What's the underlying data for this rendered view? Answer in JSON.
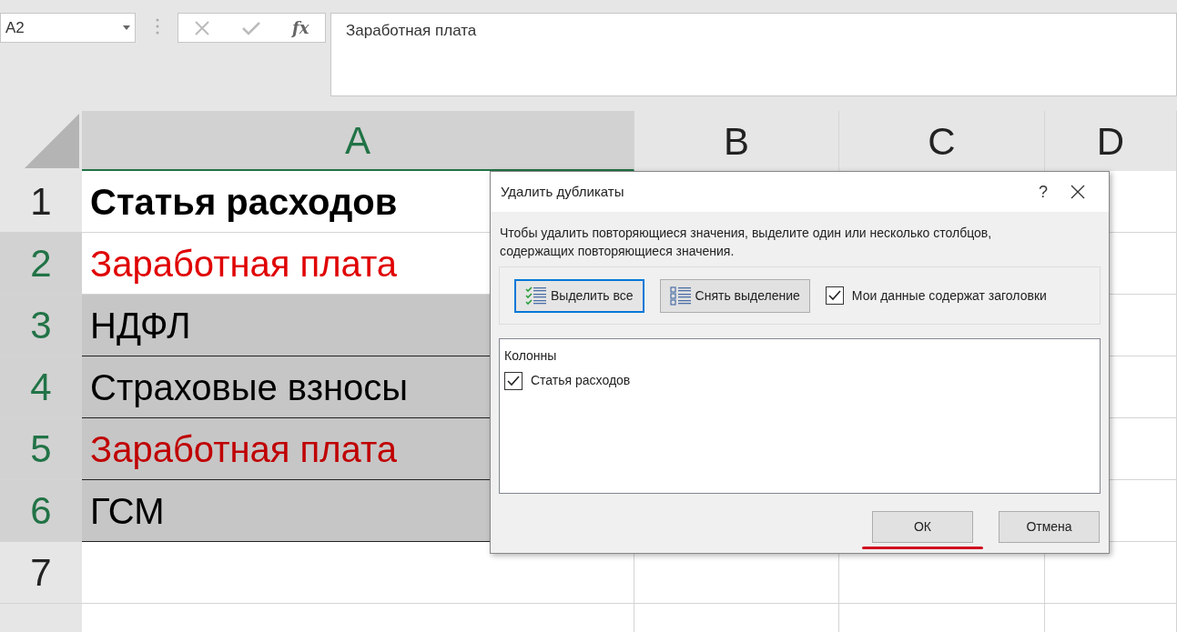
{
  "name_box": {
    "value": "A2"
  },
  "formula_bar": {
    "function_label": "fx",
    "value": "Заработная плата"
  },
  "columns": [
    {
      "label": "A",
      "selected": true
    },
    {
      "label": "B",
      "selected": false
    },
    {
      "label": "C",
      "selected": false
    },
    {
      "label": "D",
      "selected": false
    }
  ],
  "rows": [
    {
      "number": "1",
      "selected": false,
      "cell": {
        "text": "Статья расходов",
        "color": "#000000",
        "bold": true,
        "selected": false
      }
    },
    {
      "number": "2",
      "selected": true,
      "cell": {
        "text": "Заработная плата",
        "color": "#e00000",
        "bold": false,
        "selected": false
      }
    },
    {
      "number": "3",
      "selected": true,
      "cell": {
        "text": "НДФЛ",
        "color": "#000000",
        "bold": false,
        "selected": true
      }
    },
    {
      "number": "4",
      "selected": true,
      "cell": {
        "text": "Страховые взносы",
        "color": "#000000",
        "bold": false,
        "selected": true
      }
    },
    {
      "number": "5",
      "selected": true,
      "cell": {
        "text": "Заработная плата",
        "color": "#c00000",
        "bold": false,
        "selected": true
      }
    },
    {
      "number": "6",
      "selected": true,
      "cell": {
        "text": "ГСМ",
        "color": "#000000",
        "bold": false,
        "selected": true
      }
    },
    {
      "number": "7",
      "selected": false
    },
    {}
  ],
  "dialog": {
    "title": "Удалить дубликаты",
    "help": "?",
    "description": "Чтобы удалить повторяющиеся значения, выделите один или несколько столбцов, содержащих повторяющиеся значения.",
    "select_all_button": {
      "label": "Выделить все",
      "focused": true
    },
    "unselect_all_button": {
      "label": "Снять выделение",
      "focused": false
    },
    "headers_checkbox": {
      "label": "Мои данные содержат заголовки",
      "checked": true
    },
    "columns_list": {
      "heading": "Колонны",
      "items": [
        {
          "label": "Статья расходов",
          "checked": true
        }
      ]
    },
    "ok_button": {
      "label": "ОК",
      "underlined": true
    },
    "cancel_button": {
      "label": "Отмена"
    }
  }
}
